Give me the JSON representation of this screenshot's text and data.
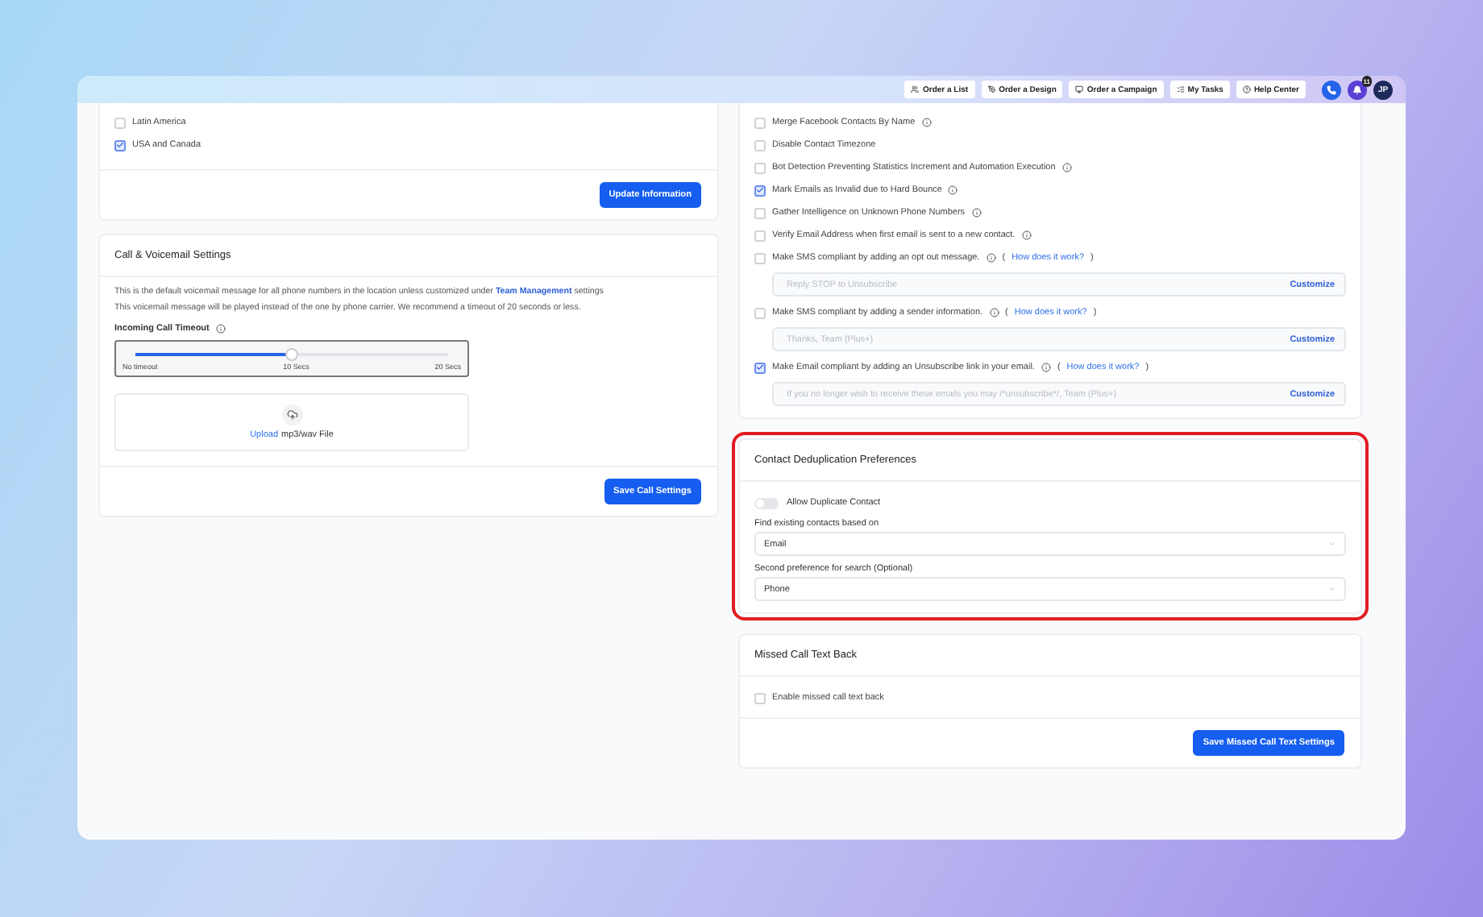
{
  "topbar": {
    "buttons": [
      {
        "label": "Order a List",
        "kind": "list"
      },
      {
        "label": "Order a Design",
        "kind": "design"
      },
      {
        "label": "Order a Campaign",
        "kind": "campaign"
      },
      {
        "label": "My Tasks",
        "kind": "tasks"
      },
      {
        "label": "Help Center",
        "kind": "help"
      }
    ],
    "notifications": "11",
    "avatar": "JP"
  },
  "regions": {
    "options": [
      {
        "label": "Latin America",
        "checked": false
      },
      {
        "label": "USA and Canada",
        "checked": true
      }
    ],
    "button": "Update Information"
  },
  "call_settings": {
    "title": "Call & Voicemail Settings",
    "description": "This is the default voicemail message for all phone numbers in the location unless customized under **Team Management** settings",
    "note": "This voicemail message will be played instead of the one by phone carrier. We recommend a timeout of 20 seconds or less.",
    "timeout": {
      "label": "Incoming Call Timeout",
      "level": 0.5,
      "ticks": [
        "No timeout",
        "10 Secs",
        "20 Secs"
      ]
    },
    "upload": {
      "link": "Upload",
      "text": "mp3/wav File"
    },
    "button": "Save Call Settings"
  },
  "contact_options": [
    {
      "label": "Merge Facebook Contacts By Name",
      "checked": false,
      "info": true
    },
    {
      "label": "Disable Contact Timezone",
      "checked": false,
      "info": false
    },
    {
      "label": "Bot Detection Preventing Statistics Increment and Automation Execution",
      "checked": false,
      "info": true
    },
    {
      "label": "Mark Emails as Invalid due to Hard Bounce",
      "checked": true,
      "info": true
    },
    {
      "label": "Gather Intelligence on Unknown Phone Numbers",
      "checked": false,
      "info": true
    },
    {
      "label": "Verify Email Address when first email is sent to a new contact.",
      "checked": false,
      "info": true
    },
    {
      "label": "Make SMS compliant by adding an opt out message.",
      "checked": false,
      "info": true,
      "open": "(",
      "link": "How does it work?",
      "close": ")",
      "field": {
        "placeholder": "Reply STOP to Unsubscribe",
        "action": "Customize"
      }
    },
    {
      "label": "Make SMS compliant by adding a sender information.",
      "checked": false,
      "info": true,
      "open": "(",
      "link": "How does it work?",
      "close": ")",
      "field": {
        "placeholder": "Thanks, Team (Plus+)",
        "action": "Customize"
      }
    },
    {
      "label": "Make Email compliant by adding an Unsubscribe link in your email.",
      "checked": true,
      "info": true,
      "open": "(",
      "link": "How does it work?",
      "close": ")",
      "field": {
        "placeholder": "If you no longer wish to receive these emails you may /*unsubscribe*/, Team (Plus+)",
        "action": "Customize"
      }
    }
  ],
  "dedup": {
    "title": "Contact Deduplication Preferences",
    "highlighted": true,
    "toggle": {
      "label": "Allow Duplicate Contact",
      "on": false
    },
    "selects": [
      {
        "label": "Find existing contacts based on",
        "value": "Email"
      },
      {
        "label": "Second preference for search (Optional)",
        "value": "Phone"
      }
    ]
  },
  "missed_call": {
    "title": "Missed Call Text Back",
    "option": {
      "label": "Enable missed call text back",
      "checked": false
    },
    "button": "Save Missed Call Text Settings"
  }
}
